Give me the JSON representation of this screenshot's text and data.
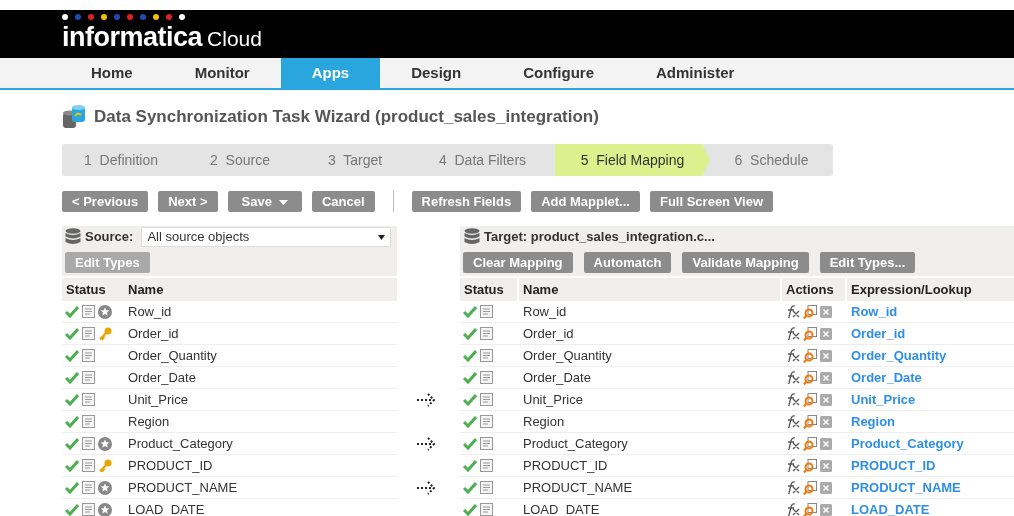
{
  "brand": {
    "name": "informatica",
    "product": "Cloud"
  },
  "nav": [
    {
      "label": "Home",
      "selected": false
    },
    {
      "label": "Monitor",
      "selected": false
    },
    {
      "label": "Apps",
      "selected": true
    },
    {
      "label": "Design",
      "selected": false
    },
    {
      "label": "Configure",
      "selected": false
    },
    {
      "label": "Administer",
      "selected": false
    }
  ],
  "page_title": "Data Synchronization Task Wizard (product_sales_integration)",
  "steps": [
    {
      "label": "1  Definition",
      "selected": false
    },
    {
      "label": "2  Source",
      "selected": false
    },
    {
      "label": "3  Target",
      "selected": false
    },
    {
      "label": "4  Data Filters",
      "selected": false
    },
    {
      "label": "5  Field Mapping",
      "selected": true
    },
    {
      "label": "6  Schedule",
      "selected": false
    }
  ],
  "toolbar": {
    "nav_buttons": [
      {
        "label": "< Previous"
      },
      {
        "label": "Next >"
      },
      {
        "label": "Save",
        "dropdown": true
      },
      {
        "label": "Cancel"
      }
    ],
    "tool_buttons": [
      {
        "label": "Refresh Fields"
      },
      {
        "label": "Add Mapplet..."
      },
      {
        "label": "Full Screen View"
      }
    ]
  },
  "source": {
    "label": "Source:",
    "value": "All source objects",
    "edit_types": {
      "label": "Edit Types",
      "disabled": true
    },
    "columns": [
      "Status",
      "Name"
    ],
    "rows": [
      {
        "name": "Row_id",
        "kind": "star",
        "mapped": false
      },
      {
        "name": "Order_id",
        "kind": "key",
        "mapped": false
      },
      {
        "name": "Order_Quantity",
        "kind": "plain",
        "mapped": false
      },
      {
        "name": "Order_Date",
        "kind": "plain",
        "mapped": false
      },
      {
        "name": "Unit_Price",
        "kind": "plain",
        "mapped": true
      },
      {
        "name": "Region",
        "kind": "plain",
        "mapped": false
      },
      {
        "name": "Product_Category",
        "kind": "star",
        "mapped": true
      },
      {
        "name": "PRODUCT_ID",
        "kind": "key",
        "mapped": false
      },
      {
        "name": "PRODUCT_NAME",
        "kind": "star",
        "mapped": true
      },
      {
        "name": "LOAD_DATE",
        "kind": "star",
        "mapped": false
      }
    ]
  },
  "target": {
    "title": "Target: product_sales_integration.c...",
    "buttons": [
      {
        "label": "Clear Mapping"
      },
      {
        "label": "Automatch"
      },
      {
        "label": "Validate Mapping"
      },
      {
        "label": "Edit Types..."
      }
    ],
    "columns": [
      "Status",
      "Name",
      "Actions",
      "Expression/Lookup"
    ],
    "rows": [
      {
        "name": "Row_id",
        "expression": "Row_id"
      },
      {
        "name": "Order_id",
        "expression": "Order_id"
      },
      {
        "name": "Order_Quantity",
        "expression": "Order_Quantity"
      },
      {
        "name": "Order_Date",
        "expression": "Order_Date"
      },
      {
        "name": "Unit_Price",
        "expression": "Unit_Price"
      },
      {
        "name": "Region",
        "expression": "Region"
      },
      {
        "name": "Product_Category",
        "expression": "Product_Category"
      },
      {
        "name": "PRODUCT_ID",
        "expression": "PRODUCT_ID"
      },
      {
        "name": "PRODUCT_NAME",
        "expression": "PRODUCT_NAME"
      },
      {
        "name": "LOAD_DATE",
        "expression": "LOAD_DATE"
      }
    ]
  }
}
